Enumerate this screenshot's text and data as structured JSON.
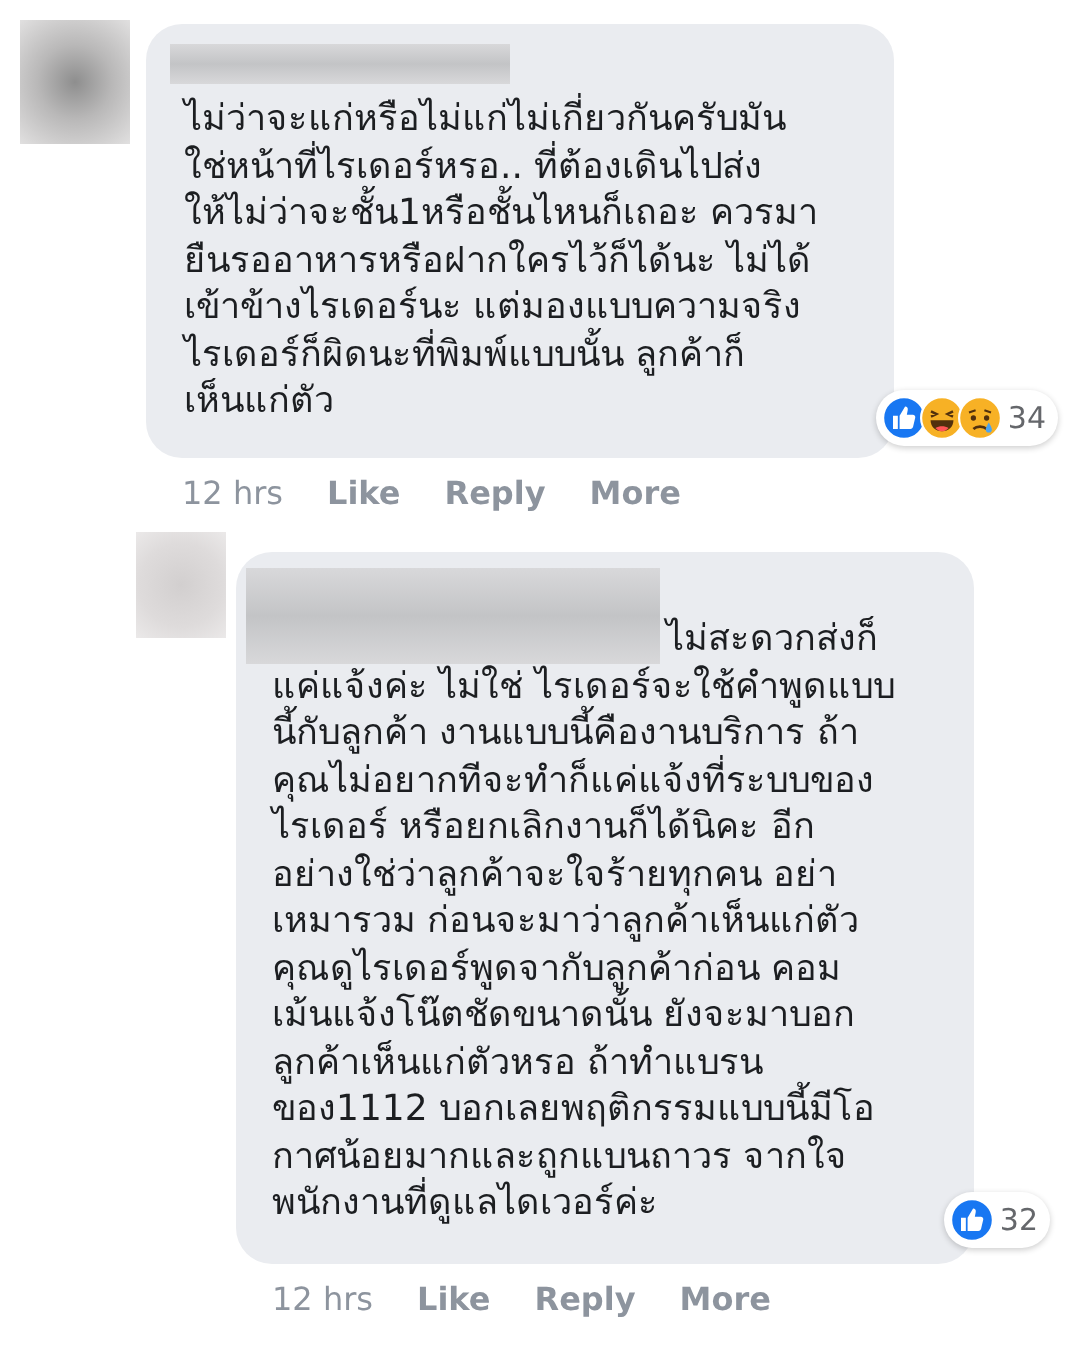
{
  "comments": [
    {
      "kind": "comment",
      "lines": [
        "ไม่ว่าจะแก่หรือไม่แก่ไม่เกี่ยวกันครับมัน",
        "ใช่หน้าที่ไรเดอร์หรอ.. ที่ต้องเดินไปส่ง",
        "ให้ไม่ว่าจะชั้น1หรือชั้นไหนก็เถอะ ควรมา",
        "ยืนรออาหารหรือฝากใครไว้ก็ได้นะ ไม่ได้",
        "เข้าข้างไรเดอร์นะ แต่มองแบบความจริง",
        "ไรเดอร์ก็ผิดนะที่พิมพ์แบบนั้น ลูกค้าก็",
        "เห็นแก่ตัว"
      ],
      "reactions": [
        {
          "kind": "like"
        },
        {
          "kind": "haha"
        },
        {
          "kind": "sad"
        }
      ],
      "reaction_count": "34",
      "time": "12 hrs",
      "actions": [
        "Like",
        "Reply",
        "More"
      ]
    },
    {
      "kind": "reply",
      "lines": [
        "ไม่สะดวกส่งก็",
        "แค่แจ้งค่ะ ไม่ใช่ ไรเดอร์จะใช้คำพูดแบบ",
        "นี้กับลูกค้า งานแบบนี้คืองานบริการ ถ้า",
        "คุณไม่อยากทีจะทำก็แค่แจ้งที่ระบบของ",
        "ไรเดอร์ หรือยกเลิกงานก็ได้นิคะ อีก",
        "อย่างใช่ว่าลูกค้าจะใจร้ายทุกคน อย่า",
        "เหมารวม ก่อนจะมาว่าลูกค้าเห็นแก่ตัว",
        "คุณดูไรเดอร์พูดจากับลูกค้าก่อน คอม",
        "เม้นแจ้งโน๊ตชัดขนาดนั้น ยังจะมาบอก",
        "ลูกค้าเห็นแก่ตัวหรอ ถ้าทำแบรน",
        "ของ1112 บอกเลยพฤติกรรมแบบนี้มีโอ",
        "กาศน้อยมากและถูกแบนถาวร จากใจ",
        "พนักงานที่ดูแลไดเวอร์ค่ะ"
      ],
      "reactions": [
        {
          "kind": "like"
        }
      ],
      "reaction_count": "32",
      "time": "12 hrs",
      "actions": [
        "Like",
        "Reply",
        "More"
      ]
    }
  ]
}
